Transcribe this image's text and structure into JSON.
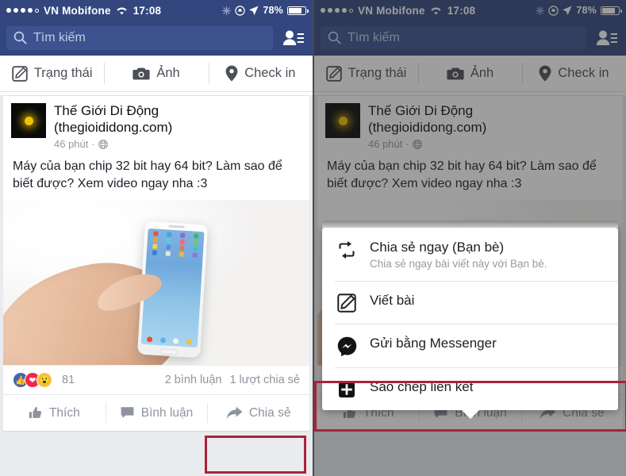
{
  "status_bar": {
    "signal_dots": 5,
    "signal_filled": 4,
    "carrier": "VN Mobifone",
    "wifi_icon": "wifi-icon",
    "time": "17:08",
    "alarm_icon": "alarm-icon",
    "rotation_lock_icon": "rotation-lock-icon",
    "location_icon": "location-arrow-icon",
    "battery_percent": "78%",
    "battery_level": 78
  },
  "header": {
    "search_placeholder": "Tìm kiếm",
    "search_icon": "search-icon",
    "friend_requests_icon": "friend-requests-icon"
  },
  "composer": {
    "buttons": [
      {
        "label": "Trạng thái",
        "icon": "compose-status-icon"
      },
      {
        "label": "Ảnh",
        "icon": "camera-icon"
      },
      {
        "label": "Check in",
        "icon": "location-pin-icon"
      }
    ]
  },
  "post": {
    "page_name": "Thế Giới Di Động",
    "page_url": "(thegioididong.com)",
    "time_ago": "46 phút",
    "privacy_icon": "globe-icon",
    "meta_separator": "·",
    "body": "Máy của bạn chip 32 bit hay 64 bit? Làm sao để biết được? Xem video ngay nha :3",
    "photo_watermark": "",
    "reactions": {
      "icons": [
        "like-reaction",
        "love-reaction",
        "wow-reaction"
      ],
      "count": "81",
      "comments": "2 bình luận",
      "shares": "1 lượt chia sẻ"
    },
    "actions": [
      {
        "label": "Thích",
        "icon": "thumbs-up-icon"
      },
      {
        "label": "Bình luận",
        "icon": "comment-icon"
      },
      {
        "label": "Chia sẻ",
        "icon": "share-arrow-icon"
      }
    ]
  },
  "share_menu": {
    "items": [
      {
        "title": "Chia sẻ ngay (Bạn bè)",
        "subtitle": "Chia sẻ ngay bài viết này với Bạn bè.",
        "icon": "share-now-icon"
      },
      {
        "title": "Viết bài",
        "subtitle": "",
        "icon": "write-post-icon"
      },
      {
        "title": "Gửi bằng Messenger",
        "subtitle": "",
        "icon": "messenger-icon"
      },
      {
        "title": "Sao chép liên kết",
        "subtitle": "",
        "icon": "copy-link-icon"
      }
    ]
  },
  "annotations": {
    "highlight_color": "#a8243a",
    "left_highlight_target": "Chia sẻ",
    "right_highlight_target": "Sao chép liên kết"
  },
  "theme": {
    "facebook_blue": "#33477e",
    "search_field_blue": "#3d5390",
    "feed_gray": "#e9ebee",
    "text_dark": "#1d2129",
    "text_muted": "#90949c"
  }
}
